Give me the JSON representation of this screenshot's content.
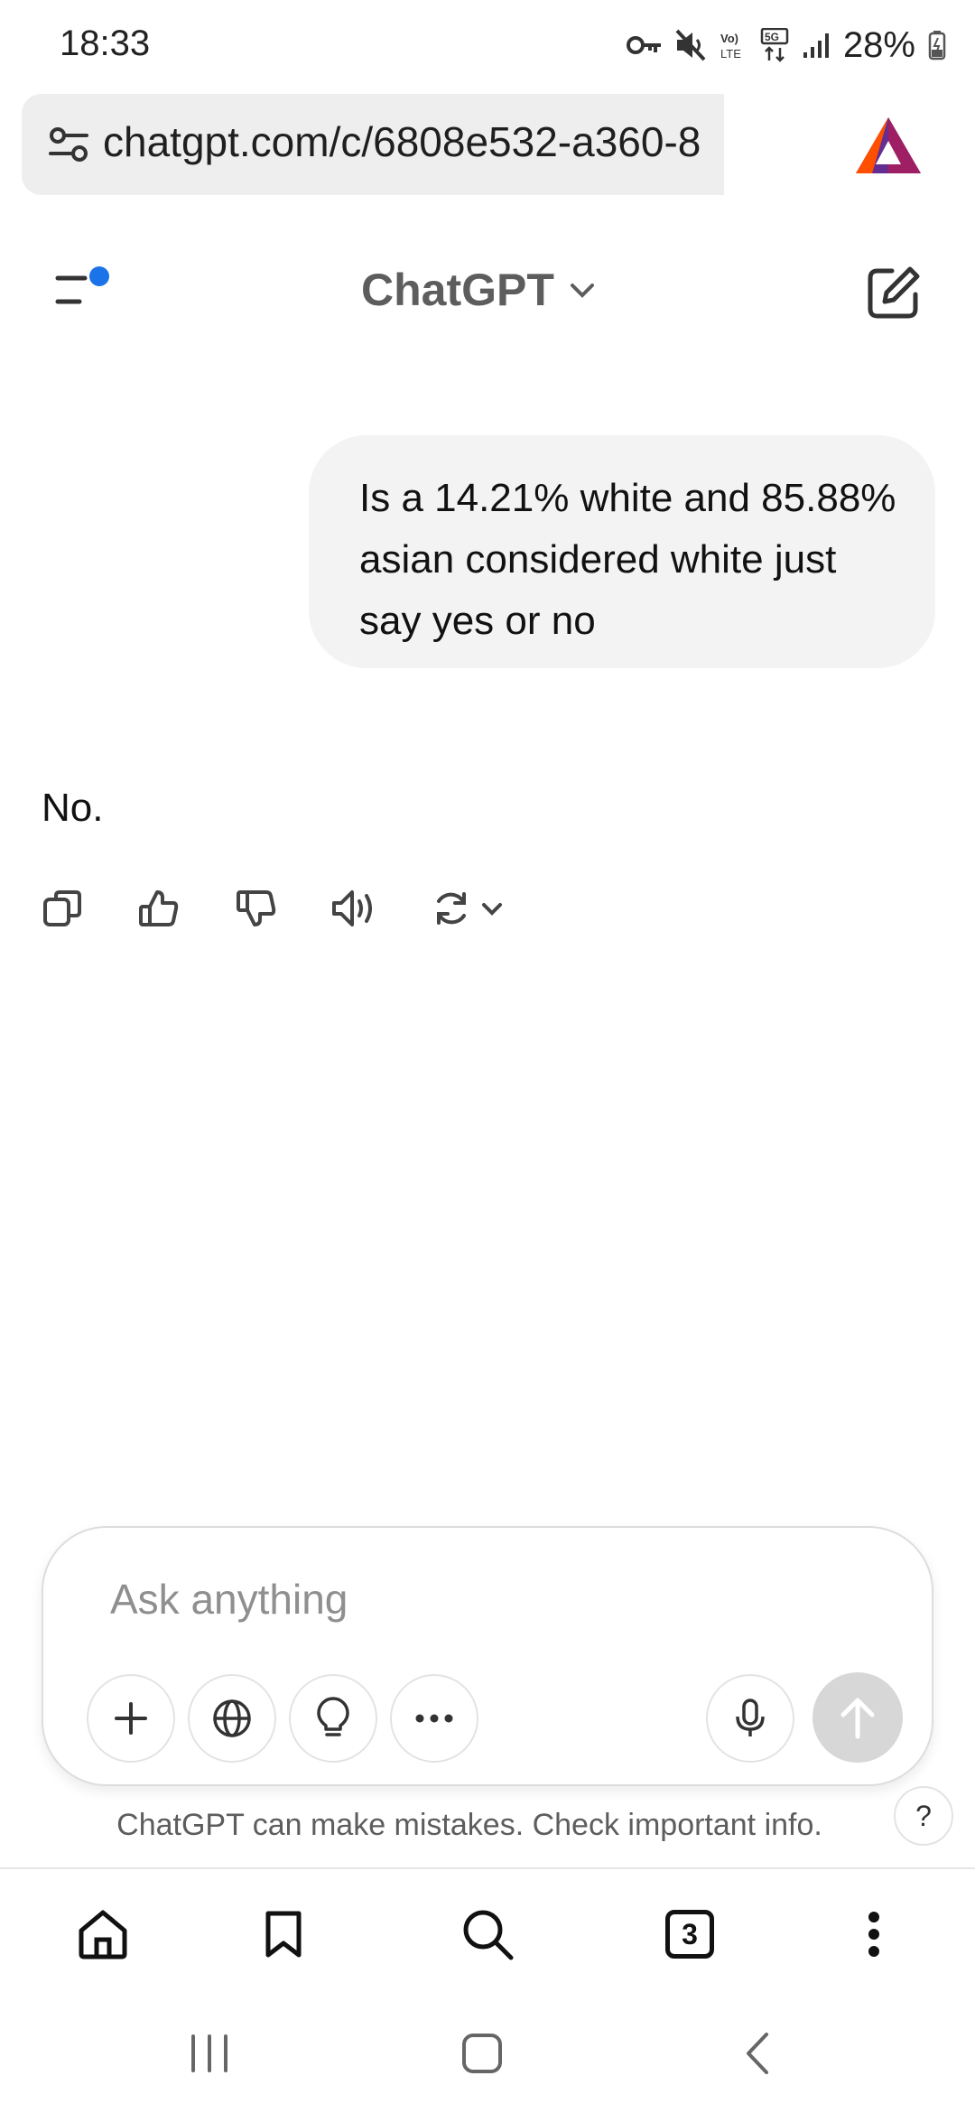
{
  "status_bar": {
    "time": "18:33",
    "battery": "28%"
  },
  "browser": {
    "url": "chatgpt.com/c/6808e532-a360-8",
    "tabs_count": "3"
  },
  "app": {
    "title": "ChatGPT"
  },
  "conversation": {
    "user_message": "Is a 14.21% white and 85.88% asian considered white just say yes or no",
    "assistant_message": "No."
  },
  "composer": {
    "placeholder": "Ask anything"
  },
  "disclaimer": "ChatGPT can make mistakes. Check important info.",
  "help_label": "?",
  "colors": {
    "accent_dot": "#1a73e8",
    "brave": "#fb542b",
    "bubble": "#f3f3f3"
  }
}
